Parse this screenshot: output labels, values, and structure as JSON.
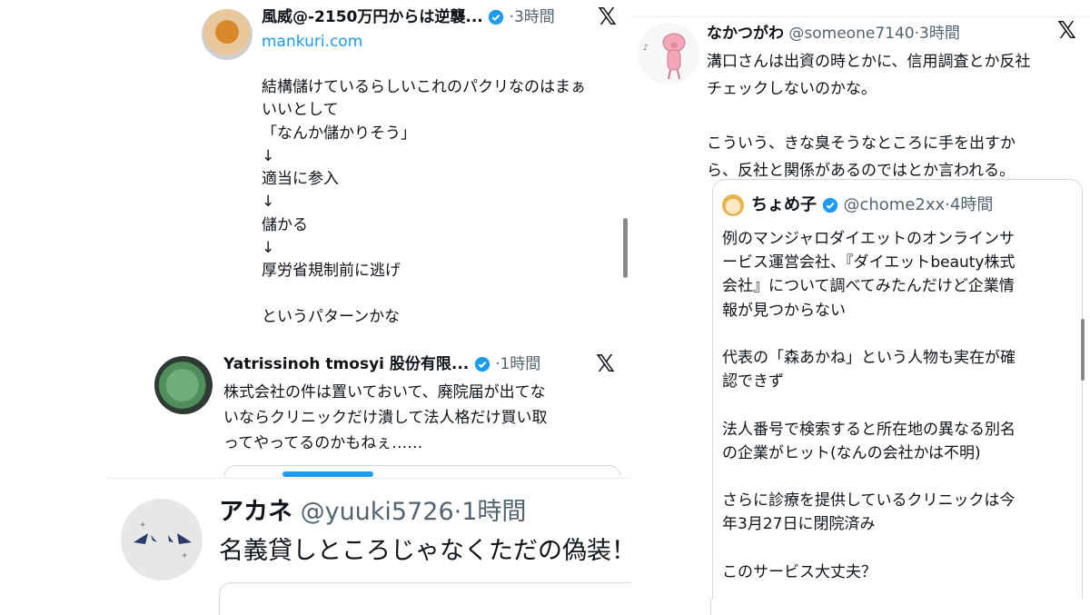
{
  "tweet1": {
    "name": "風威@-2150万円からは逆襲...",
    "time": "3時間",
    "x_logo": "𝕏",
    "link": "mankuri.com",
    "body": "結構儲けているらしいこれのパクリなのはまぁ\nいいとして\n「なんか儲かりそう」\n↓\n適当に参入\n↓\n儲かる\n↓\n厚労省規制前に逃げ\n\nというパターンかな"
  },
  "tweet2": {
    "name": "Yatrissinoh tmosyi 股份有限...",
    "time": "1時間",
    "x_logo": "𝕏",
    "body": "株式会社の件は置いておいて、廃院届が出てな\nいならクリニックだけ潰して法人格だけ買い取\nってやってるのかもねぇ……"
  },
  "tweet3": {
    "name": "アカネ",
    "handle": "@yuuki5726",
    "time": "1時間",
    "body": "名義貸しところじゃなくただの偽装！？"
  },
  "tweet4": {
    "name": "なかつがわ",
    "handle": "@someone7140",
    "time": "3時間",
    "x_logo": "𝕏",
    "body": "溝口さんは出資の時とかに、信用調査とか反社\nチェックしないのかな。\n\nこういう、きな臭そうなところに手を出すか\nら、反社と関係があるのではとか言われる。",
    "quote": {
      "name": "ちょめ子",
      "handle": "@chome2xx",
      "time": "4時間",
      "body": "例のマンジャロダイエットのオンラインサ\nービス運営会社、『ダイエットbeauty株式\n会社』について調べてみたんだけど企業情\n報が見つからない\n\n代表の「森あかね」という人物も実在が確\n認できず\n\n法人番号で検索すると所在地の異なる別名\nの企業がヒット(なんの会社かは不明)\n\nさらに診療を提供しているクリニックは今\n年3月27日に閉院済み\n\nこのサービス大丈夫？"
    }
  },
  "colors": {
    "verified": "#1d9bf0",
    "meta": "#536471",
    "link": "#1d9bf0"
  }
}
